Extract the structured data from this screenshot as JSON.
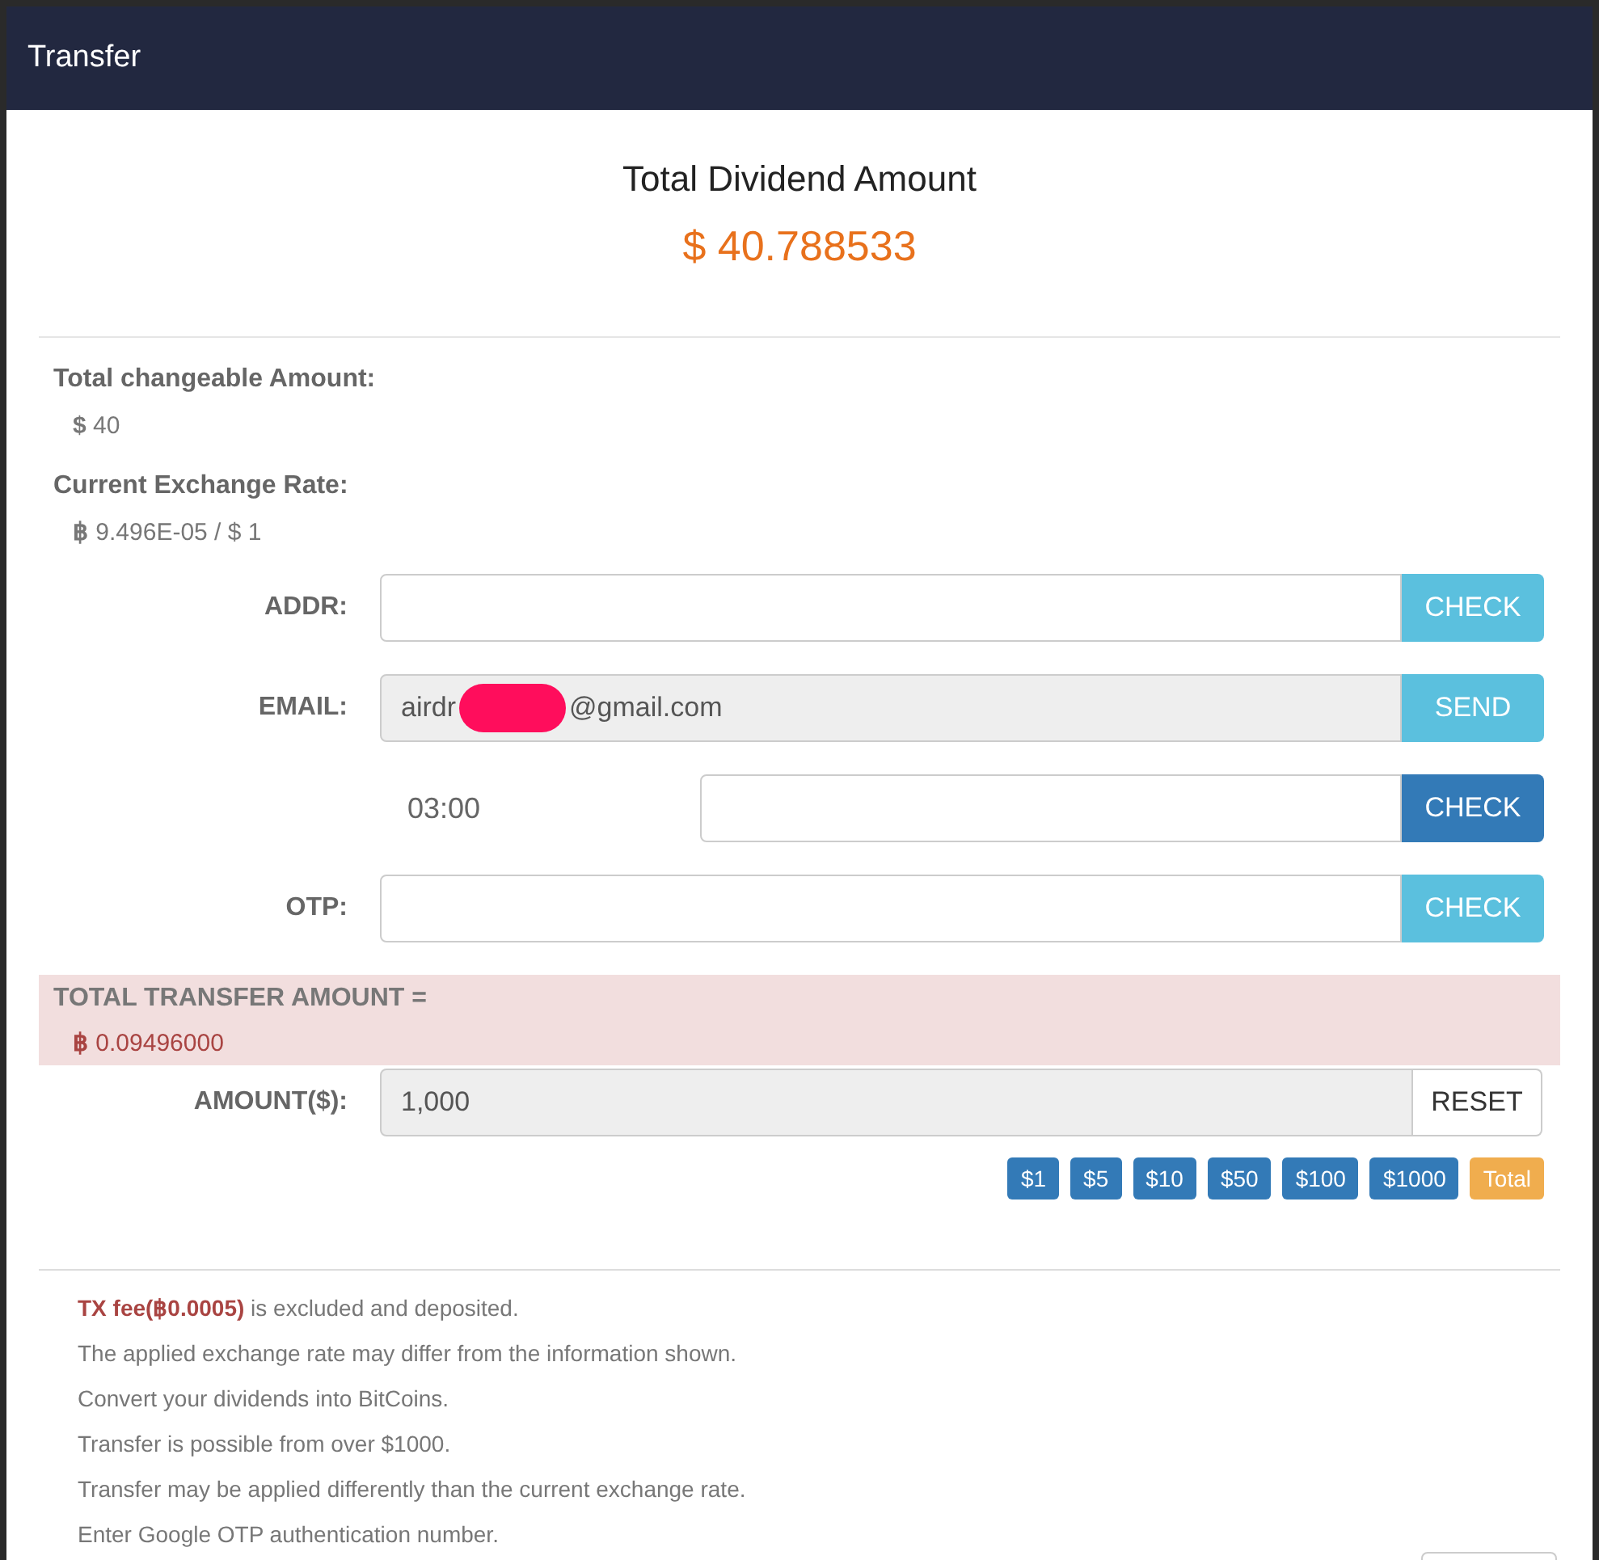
{
  "window": {
    "title": "Transfer"
  },
  "dividend": {
    "title": "Total Dividend Amount",
    "amount": "$ 40.788533"
  },
  "info": [
    {
      "label": "Total changeable Amount:",
      "value_symbol": "$",
      "value": "40"
    },
    {
      "label": "Current Exchange Rate:",
      "value_symbol": "฿",
      "value": "9.496E-05 / $ 1"
    }
  ],
  "fields": [
    {
      "kind": "input",
      "label": "ADDR:",
      "disabled": false,
      "button": {
        "label": "CHECK",
        "color": "#5bc0de"
      }
    },
    {
      "kind": "email",
      "label": "EMAIL:",
      "value_start": "airdr",
      "value_end": "@gmail.com",
      "redacted": true,
      "disabled": true,
      "button": {
        "label": "SEND",
        "color": "#5bc0de"
      }
    },
    {
      "kind": "timer",
      "timer": "03:00",
      "disabled": false,
      "button": {
        "label": "CHECK",
        "color": "#337ab7"
      }
    },
    {
      "kind": "input",
      "label": "OTP:",
      "disabled": false,
      "button": {
        "label": "CHECK",
        "color": "#5bc0de"
      }
    }
  ],
  "total": {
    "label": "TOTAL TRANSFER AMOUNT =",
    "symbol": "฿",
    "value": "0.09496000"
  },
  "amount": {
    "label": "AMOUNT($):",
    "value": "1,000",
    "disabled": true,
    "button": "RESET"
  },
  "quick_buttons": [
    {
      "label": "$1",
      "kind": "amount"
    },
    {
      "label": "$5",
      "kind": "amount"
    },
    {
      "label": "$10",
      "kind": "amount"
    },
    {
      "label": "$50",
      "kind": "amount"
    },
    {
      "label": "$100",
      "kind": "amount"
    },
    {
      "label": "$1000",
      "kind": "amount"
    },
    {
      "label": "Total",
      "kind": "total"
    }
  ],
  "notes": [
    {
      "highlight": "TX fee(฿0.0005)",
      "text": " is excluded and deposited."
    },
    {
      "text": "The applied exchange rate may differ from the information shown."
    },
    {
      "text": "Convert your dividends into BitCoins."
    },
    {
      "text": "Transfer is possible from over $1000."
    },
    {
      "text": "Transfer may be applied differently than the current exchange rate."
    },
    {
      "text": "Enter Google OTP authentication number."
    }
  ]
}
